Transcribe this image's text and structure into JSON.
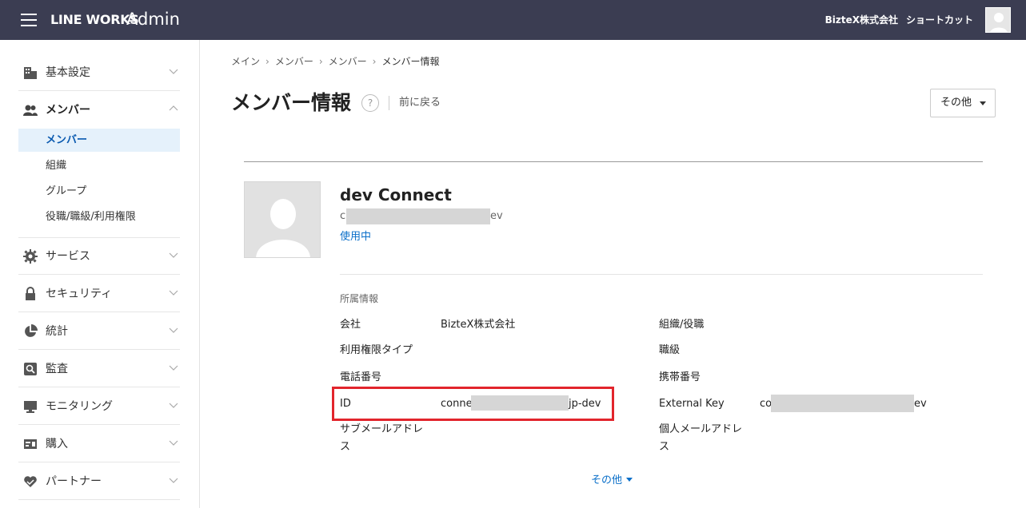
{
  "header": {
    "brand": "LINE WORKS",
    "brand_suffix": "Admin",
    "company": "BizteX株式会社",
    "shortcut": "ショートカット"
  },
  "sidebar": {
    "sections": [
      {
        "label": "基本設定",
        "icon": "building-icon"
      },
      {
        "label": "メンバー",
        "icon": "members-icon",
        "expanded": true
      },
      {
        "label": "サービス",
        "icon": "gear-icon"
      },
      {
        "label": "セキュリティ",
        "icon": "lock-icon"
      },
      {
        "label": "統計",
        "icon": "pie-chart-icon"
      },
      {
        "label": "監査",
        "icon": "audit-icon"
      },
      {
        "label": "モニタリング",
        "icon": "monitor-icon"
      },
      {
        "label": "購入",
        "icon": "purchase-icon"
      },
      {
        "label": "パートナー",
        "icon": "partner-icon"
      }
    ],
    "member_subitems": [
      "メンバー",
      "組織",
      "グループ",
      "役職/職級/利用権限"
    ]
  },
  "breadcrumb": [
    "メイン",
    "メンバー",
    "メンバー",
    "メンバー情報"
  ],
  "page": {
    "title": "メンバー情報",
    "help": "?",
    "back": "前に戻る",
    "more_button": "その他"
  },
  "profile": {
    "name": "dev Connect",
    "email_prefix": "c",
    "email_suffix": "ev",
    "status": "使用中"
  },
  "affiliation": {
    "section_label": "所属情報",
    "left": [
      {
        "key": "会社",
        "value": "BizteX株式会社"
      },
      {
        "key": "利用権限タイプ",
        "value": ""
      },
      {
        "key": "電話番号",
        "value": ""
      },
      {
        "key": "ID",
        "value_prefix": "conne",
        "value_suffix": "jp-dev"
      },
      {
        "key": "サブメールアドレ\nス",
        "value": ""
      }
    ],
    "right": [
      {
        "key": "組織/役職",
        "value": ""
      },
      {
        "key": "職級",
        "value": ""
      },
      {
        "key": "携帯番号",
        "value": ""
      },
      {
        "key": "External Key",
        "value_prefix": "co",
        "value_suffix": "ev"
      },
      {
        "key": "個人メールアドレ\nス",
        "value": ""
      }
    ],
    "more_link": "その他"
  },
  "colors": {
    "header_bg": "#3b3d52",
    "accent": "#0a6fc9",
    "highlight": "#e2252c",
    "selected_bg": "#e5f1fb"
  }
}
